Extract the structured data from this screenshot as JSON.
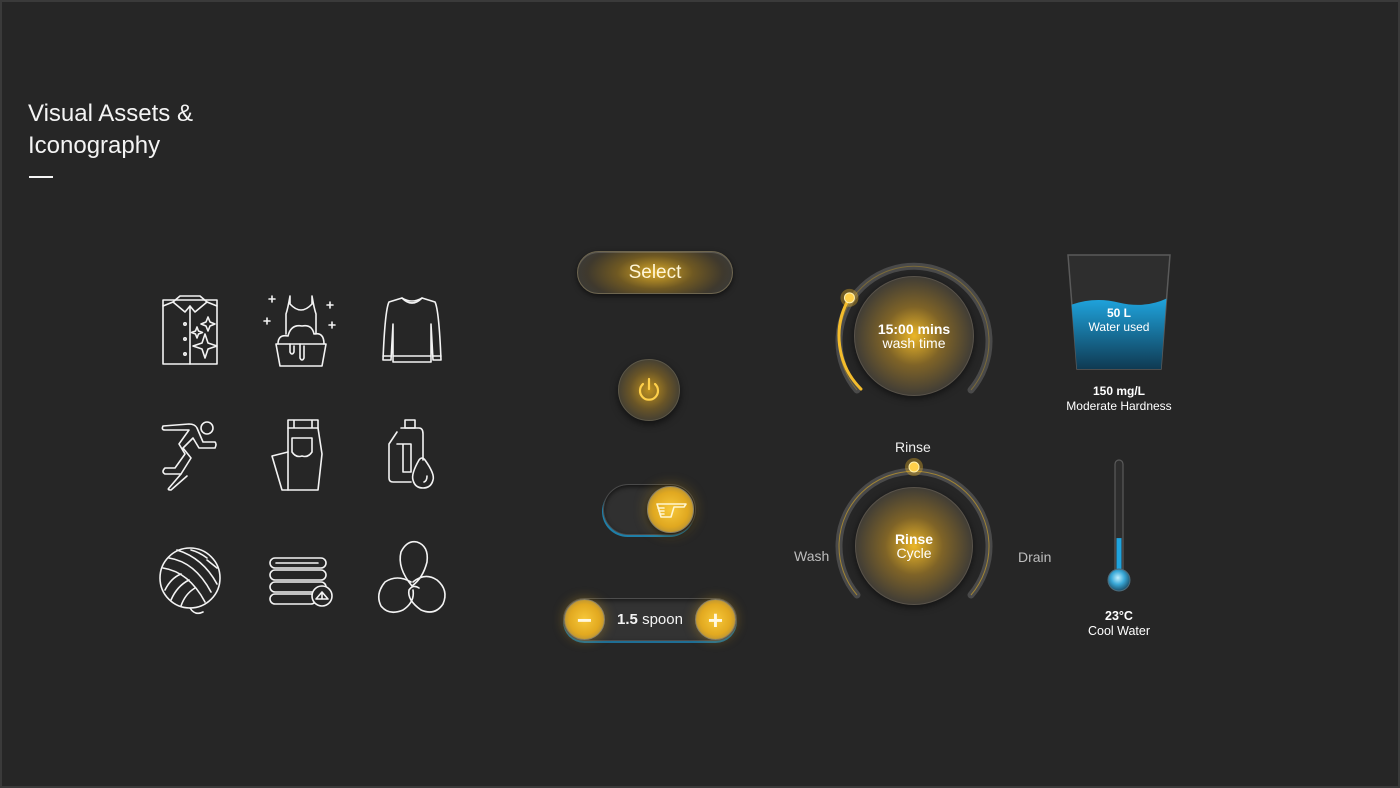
{
  "header": {
    "title_line1": "Visual Assets &",
    "title_line2": "Iconography"
  },
  "icons": [
    {
      "name": "shirt-sparkle-icon",
      "label": "Clean shirt"
    },
    {
      "name": "tank-top-wash-basin-icon",
      "label": "Hand wash"
    },
    {
      "name": "sweater-icon",
      "label": "Sweater"
    },
    {
      "name": "running-person-icon",
      "label": "Sportswear"
    },
    {
      "name": "jeans-icon",
      "label": "Jeans"
    },
    {
      "name": "detergent-bottle-drop-icon",
      "label": "Detergent"
    },
    {
      "name": "yarn-ball-icon",
      "label": "Wool"
    },
    {
      "name": "folded-towels-icon",
      "label": "Towels"
    },
    {
      "name": "trefoil-knot-icon",
      "label": "Delicates"
    }
  ],
  "controls": {
    "select_label": "Select",
    "power_icon": "power-icon",
    "toggle_icon": "detergent-scoop-icon",
    "toggle_on": true,
    "stepper": {
      "minus": "−",
      "plus": "+",
      "value": "1.5",
      "unit": "spoon"
    }
  },
  "timer_dial": {
    "value": "15:00 mins",
    "label": "wash time",
    "progress_fraction": 0.28
  },
  "cycle_dial": {
    "top_label": "Rinse",
    "left_label": "Wash",
    "right_label": "Drain",
    "center_line1": "Rinse",
    "center_line2": "Cycle",
    "stages": [
      "Wash",
      "Rinse",
      "Drain"
    ],
    "current_stage": "Rinse"
  },
  "water": {
    "amount": "50 L",
    "label": "Water used",
    "fill_fraction": 0.6,
    "hardness_value": "150 mg/L",
    "hardness_label": "Moderate Hardness"
  },
  "temperature": {
    "value": "23°C",
    "label": "Cool Water",
    "fill_fraction": 0.35
  },
  "colors": {
    "background": "#262626",
    "accent_gold": "#f5c230",
    "accent_blue": "#1b9ad6",
    "text": "#f4f4f4"
  }
}
